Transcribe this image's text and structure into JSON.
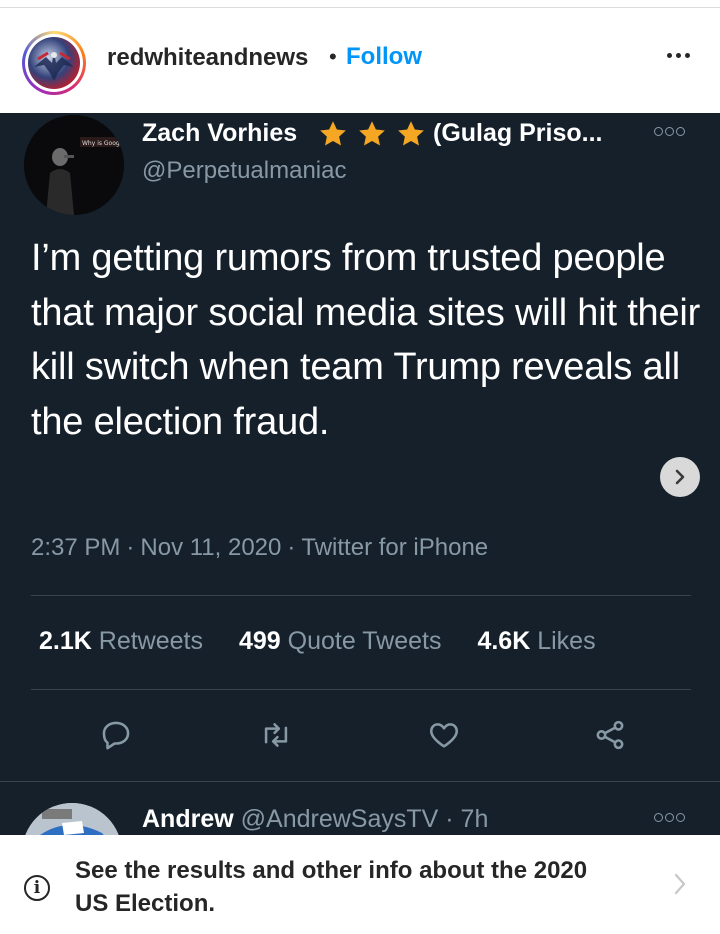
{
  "instagram": {
    "username": "redwhiteandnews",
    "separator": "•",
    "follow_label": "Follow",
    "more_icon": "more-horizontal-icon"
  },
  "tweet": {
    "author_name": "Zach Vorhies",
    "stars": 3,
    "star_color": "#f5a623",
    "author_name_suffix": "(Gulag Priso...",
    "handle": "@Perpetualmaniac",
    "text": "I’m getting rumors from trusted people that major social media sites will hit their kill switch when team Trump reveals all the election fraud.",
    "time": "2:37 PM",
    "date": "Nov 11, 2020",
    "source": "Twitter for iPhone",
    "meta_separator": "·",
    "stats": {
      "retweets_count": "2.1K",
      "retweets_label": "Retweets",
      "quote_count": "499",
      "quote_label": "Quote Tweets",
      "likes_count": "4.6K",
      "likes_label": "Likes"
    },
    "actions": [
      "reply-icon",
      "retweet-icon",
      "like-icon",
      "share-icon"
    ],
    "background": "#15202b",
    "secondary_text_color": "#8899a6"
  },
  "reply": {
    "name": "Andrew",
    "handle": "@AndrewSaysTV",
    "time": "7h",
    "separator": "·"
  },
  "info_banner": {
    "text": "See the results and other info about the 2020 US Election.",
    "icon": "info-icon"
  },
  "colors": {
    "follow": "#0095f6",
    "tweet_bg": "#15202b",
    "divider": "#38444d"
  }
}
